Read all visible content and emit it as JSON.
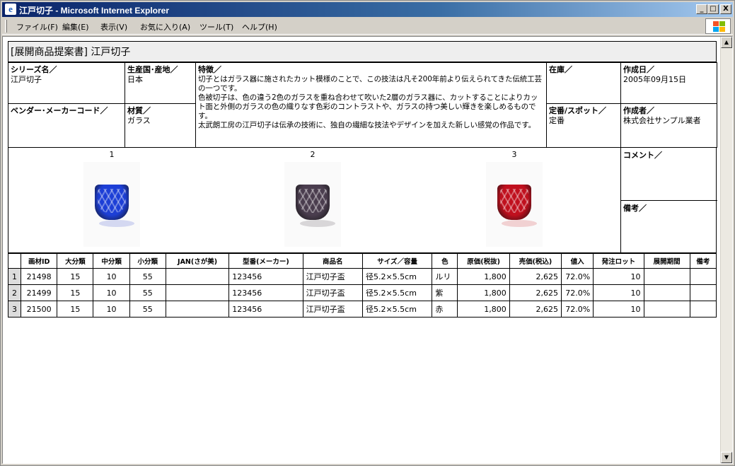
{
  "window": {
    "title": "江戸切子 - Microsoft Internet Explorer",
    "buttons": {
      "minimize": "_",
      "maximize": "□",
      "close": "X"
    }
  },
  "menu": [
    "ファイル(F)",
    "編集(E)",
    "表示(V)",
    "お気に入り(A)",
    "ツール(T)",
    "ヘルプ(H)"
  ],
  "document": {
    "header_title": "[展開商品提案書]  江戸切子",
    "series": {
      "label": "シリーズ名／",
      "value": "江戸切子"
    },
    "origin": {
      "label": "生産国･産地／",
      "value": "日本"
    },
    "features": {
      "label": "特徴／",
      "lines": [
        "切子とはガラス器に施されたカット模様のことで、この技法は凡そ200年前より伝えられてきた伝統工芸の一つです。",
        "色被切子は、色の違う2色のガラスを重ね合わせて吹いた2層のガラス器に、カットすることによりカット面と外側のガラスの色の織りなす色彩のコントラストや、ガラスの持つ美しい輝きを楽しめるものです。",
        "太武朗工房の江戸切子は伝承の技術に、独自の繊細な技法やデザインを加えた新しい感覚の作品です。"
      ]
    },
    "stock": {
      "label": "在庫／",
      "value": ""
    },
    "created_date": {
      "label": "作成日／",
      "value": "2005年09月15日"
    },
    "vendor_code": {
      "label": "ベンダー･メーカーコード／",
      "value": ""
    },
    "material": {
      "label": "材質／",
      "value": "ガラス"
    },
    "regular_spot": {
      "label": "定番/スポット／",
      "value": "定番"
    },
    "author": {
      "label": "作成者／",
      "value": "株式会社サンプル業者"
    },
    "images": [
      {
        "number": "1",
        "color": "#1d3fd6",
        "name": "blue-kiriko-cup"
      },
      {
        "number": "2",
        "color": "#4a3d4e",
        "name": "purple-kiriko-cup"
      },
      {
        "number": "3",
        "color": "#c0101e",
        "name": "red-kiriko-cup"
      }
    ],
    "comment_label": "コメント／",
    "remarks_label": "備考／",
    "items_table": {
      "headers": [
        "",
        "画材ID",
        "大分類",
        "中分類",
        "小分類",
        "JAN(さが美)",
        "型番(メーカー)",
        "商品名",
        "サイズ／容量",
        "色",
        "原価(税抜)",
        "売価(税込)",
        "値入",
        "発注ロット",
        "展開期間",
        "備考"
      ],
      "rows": [
        [
          "1",
          "21498",
          "15",
          "10",
          "55",
          "",
          "123456",
          "江戸切子盃",
          "径5.2×5.5cm",
          "ルリ",
          "1,800",
          "2,625",
          "72.0%",
          "10",
          "",
          ""
        ],
        [
          "2",
          "21499",
          "15",
          "10",
          "55",
          "",
          "123456",
          "江戸切子盃",
          "径5.2×5.5cm",
          "紫",
          "1,800",
          "2,625",
          "72.0%",
          "10",
          "",
          ""
        ],
        [
          "3",
          "21500",
          "15",
          "10",
          "55",
          "",
          "123456",
          "江戸切子盃",
          "径5.2×5.5cm",
          "赤",
          "1,800",
          "2,625",
          "72.0%",
          "10",
          "",
          ""
        ]
      ]
    }
  }
}
